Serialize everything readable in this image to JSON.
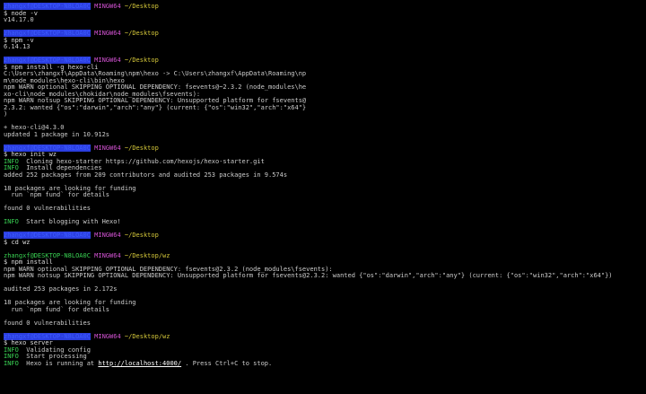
{
  "colors": {
    "background": "#000000",
    "user_host": "#39d353",
    "env": "#d453d4",
    "dir": "#d4c73a",
    "text": "#cccccc"
  },
  "prompts": {
    "user_host": "zhangxf@DESKTOP-N8LOA0C",
    "user_host_redacted": "@DESKTOP-N8LOA0C",
    "env": "MINGW64",
    "dir_desktop": "~/Desktop",
    "dir_wz": "~/Desktop/wz",
    "symbol": "$"
  },
  "blocks": [
    {
      "command": "node -v",
      "output": [
        "v14.17.0"
      ]
    },
    {
      "command": "npm -v",
      "output": [
        "6.14.13"
      ]
    },
    {
      "command": "npm install -g hexo-cli",
      "output": [
        "C:\\Users\\zhangxf\\AppData\\Roaming\\npm\\hexo -> C:\\Users\\zhangxf\\AppData\\Roaming\\np",
        "m\\node_modules\\hexo-cli\\bin\\hexo",
        "npm WARN optional SKIPPING OPTIONAL DEPENDENCY: fsevents@~2.3.2 (node_modules\\he",
        "xo-cli\\node_modules\\chokidar\\node_modules\\fsevents):",
        "npm WARN notsup SKIPPING OPTIONAL DEPENDENCY: Unsupported platform for fsevents@",
        "2.3.2: wanted {\"os\":\"darwin\",\"arch\":\"any\"} (current: {\"os\":\"win32\",\"arch\":\"x64\"}",
        ")",
        "",
        "+ hexo-cli@4.3.0",
        "updated 1 package in 10.912s"
      ]
    },
    {
      "command": "hexo init wz",
      "output_info": [
        {
          "tag": "INFO",
          "text": "  Cloning hexo-starter https://github.com/hexojs/hexo-starter.git"
        },
        {
          "tag": "INFO",
          "text": "  Install dependencies"
        }
      ],
      "output": [
        "added 252 packages from 209 contributors and audited 253 packages in 9.574s",
        "",
        "18 packages are looking for funding",
        "  run `npm fund` for details",
        "",
        "found 0 vulnerabilities",
        ""
      ],
      "output_info_tail": {
        "tag": "INFO",
        "text": "  Start blogging with Hexo!"
      }
    },
    {
      "command": "cd wz",
      "output": []
    },
    {
      "command": "npm install",
      "output": [
        "npm WARN optional SKIPPING OPTIONAL DEPENDENCY: fsevents@2.3.2 (node_modules\\fsevents):",
        "npm WARN notsup SKIPPING OPTIONAL DEPENDENCY: Unsupported platform for fsevents@2.3.2: wanted {\"os\":\"darwin\",\"arch\":\"any\"} (current: {\"os\":\"win32\",\"arch\":\"x64\"})",
        "",
        "audited 253 packages in 2.172s",
        "",
        "18 packages are looking for funding",
        "  run `npm fund` for details",
        "",
        "found 0 vulnerabilities"
      ]
    },
    {
      "command": "hexo server",
      "info_lines": [
        {
          "tag": "INFO",
          "text": "  Validating config"
        },
        {
          "tag": "INFO",
          "text": "  Start processing"
        },
        {
          "tag": "INFO",
          "text": "  Hexo is running at "
        }
      ],
      "server_url": "http://localhost:4000/",
      "server_tail": " . Press Ctrl+C to stop."
    }
  ]
}
